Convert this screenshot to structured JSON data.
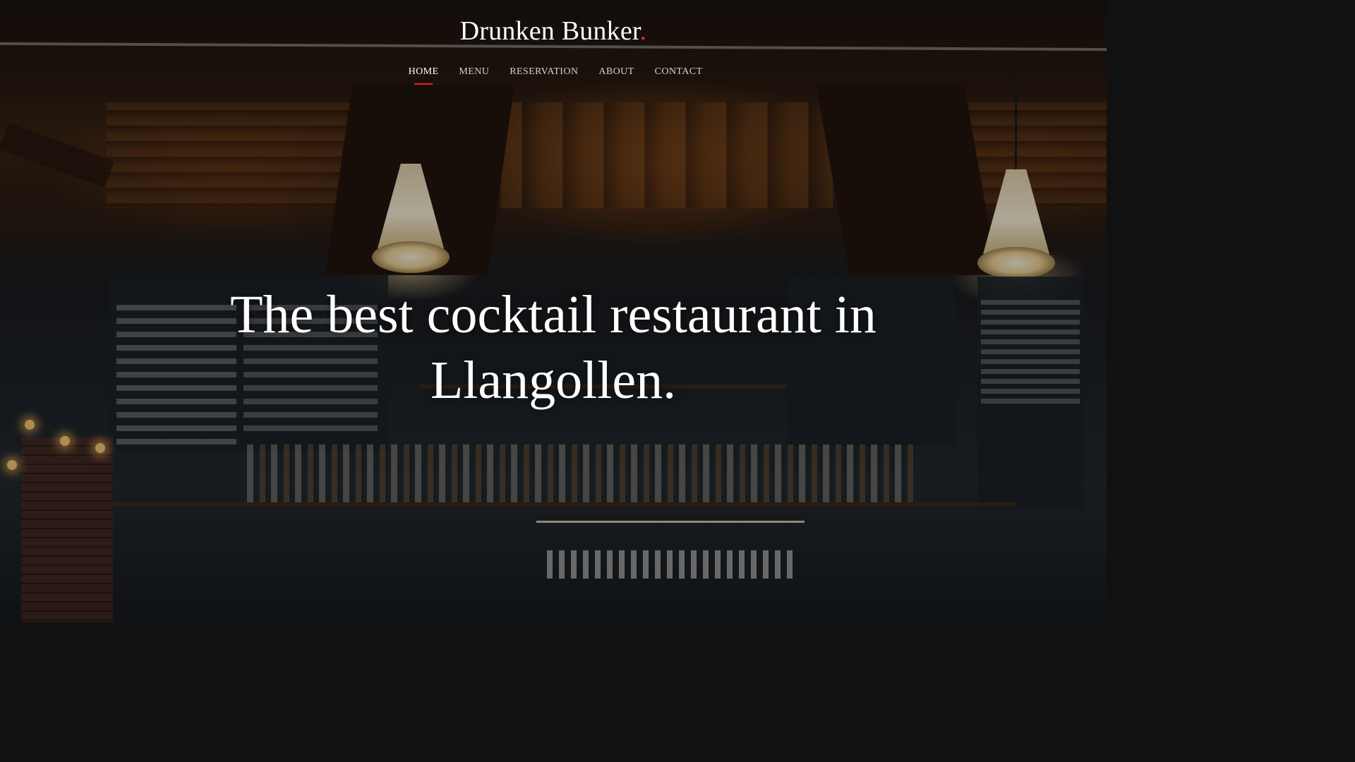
{
  "brand": {
    "name": "Drunken Bunker",
    "dot": ".",
    "accent_color": "#e8212e"
  },
  "nav": {
    "items": [
      {
        "label": "HOME",
        "active": true
      },
      {
        "label": "MENU",
        "active": false
      },
      {
        "label": "RESERVATION",
        "active": false
      },
      {
        "label": "ABOUT",
        "active": false
      },
      {
        "label": "CONTACT",
        "active": false
      }
    ]
  },
  "hero": {
    "headline_line1": "The best cocktail restaurant in",
    "headline_line2": "Llangollen.",
    "background_image": "dimmed photo of a bar interior with pendant lamps, chalkboard menus and bottle shelves"
  }
}
